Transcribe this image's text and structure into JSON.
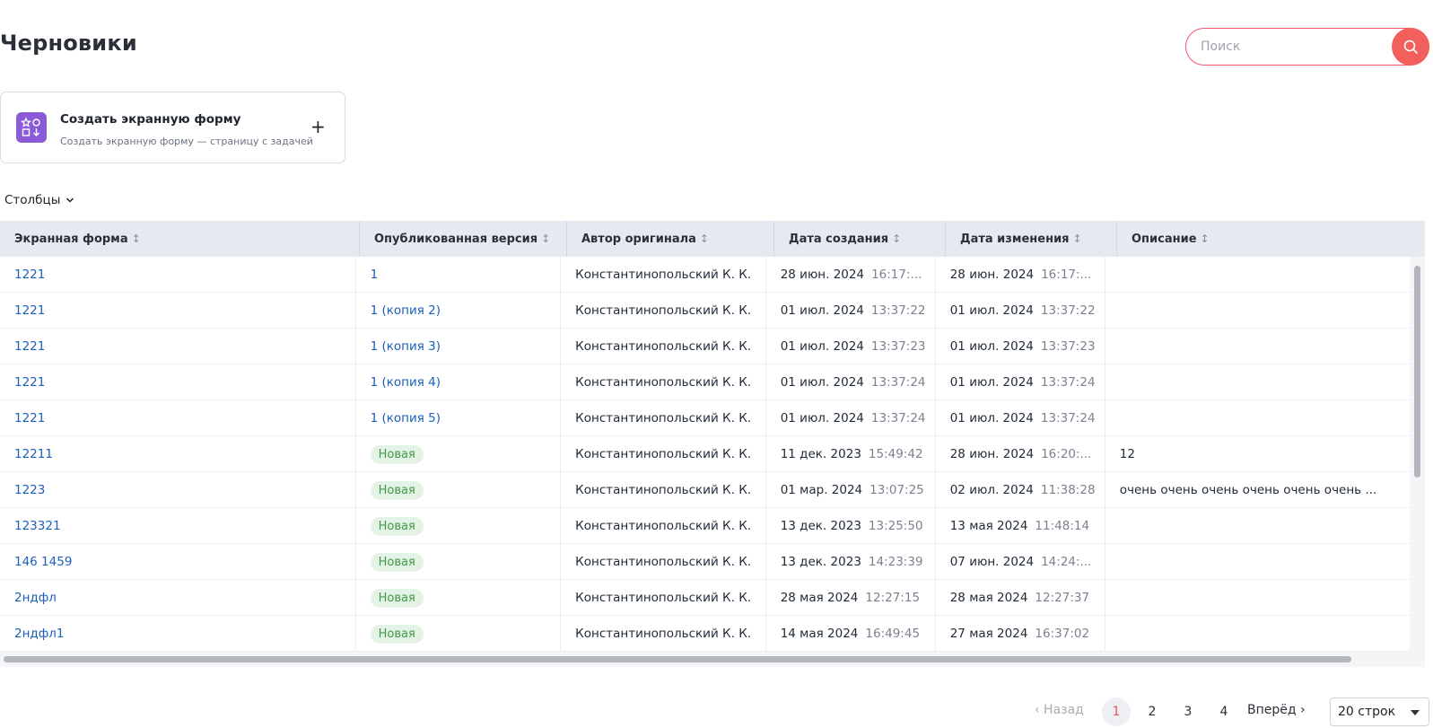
{
  "page": {
    "title": "Черновики"
  },
  "search": {
    "placeholder": "Поиск"
  },
  "create_card": {
    "title": "Создать экранную форму",
    "subtitle": "Создать экранную форму — страницу с задачей",
    "plus": "+"
  },
  "columns_toggle": {
    "label": "Столбцы"
  },
  "table": {
    "headers": [
      "Экранная форма",
      "Опубликованная версия",
      "Автор оригинала",
      "Дата создания",
      "Дата изменения",
      "Описание"
    ],
    "sort_glyph": "↕",
    "rows": [
      {
        "form": "1221",
        "version": "1",
        "version_type": "link",
        "author": "Константинопольский К. К.",
        "created_date": "28 июн. 2024",
        "created_time": "16:17:...",
        "modified_date": "28 июн. 2024",
        "modified_time": "16:17:...",
        "description": ""
      },
      {
        "form": "1221",
        "version": "1 (копия 2)",
        "version_type": "link",
        "author": "Константинопольский К. К.",
        "created_date": "01 июл. 2024",
        "created_time": "13:37:22",
        "modified_date": "01 июл. 2024",
        "modified_time": "13:37:22",
        "description": ""
      },
      {
        "form": "1221",
        "version": "1 (копия 3)",
        "version_type": "link",
        "author": "Константинопольский К. К.",
        "created_date": "01 июл. 2024",
        "created_time": "13:37:23",
        "modified_date": "01 июл. 2024",
        "modified_time": "13:37:23",
        "description": ""
      },
      {
        "form": "1221",
        "version": "1 (копия 4)",
        "version_type": "link",
        "author": "Константинопольский К. К.",
        "created_date": "01 июл. 2024",
        "created_time": "13:37:24",
        "modified_date": "01 июл. 2024",
        "modified_time": "13:37:24",
        "description": ""
      },
      {
        "form": "1221",
        "version": "1 (копия 5)",
        "version_type": "link",
        "author": "Константинопольский К. К.",
        "created_date": "01 июл. 2024",
        "created_time": "13:37:24",
        "modified_date": "01 июл. 2024",
        "modified_time": "13:37:24",
        "description": ""
      },
      {
        "form": "12211",
        "version": "Новая",
        "version_type": "badge",
        "author": "Константинопольский К. К.",
        "created_date": "11 дек. 2023",
        "created_time": "15:49:42",
        "modified_date": "28 июн. 2024",
        "modified_time": "16:20:...",
        "description": "12"
      },
      {
        "form": "1223",
        "version": "Новая",
        "version_type": "badge",
        "author": "Константинопольский К. К.",
        "created_date": "01 мар. 2024",
        "created_time": "13:07:25",
        "modified_date": "02 июл. 2024",
        "modified_time": "11:38:28",
        "description": "очень очень очень очень очень очень ..."
      },
      {
        "form": "123321",
        "version": "Новая",
        "version_type": "badge",
        "author": "Константинопольский К. К.",
        "created_date": "13 дек. 2023",
        "created_time": "13:25:50",
        "modified_date": "13 мая 2024",
        "modified_time": "11:48:14",
        "description": ""
      },
      {
        "form": "146 1459",
        "version": "Новая",
        "version_type": "badge",
        "author": "Константинопольский К. К.",
        "created_date": "13 дек. 2023",
        "created_time": "14:23:39",
        "modified_date": "07 июн. 2024",
        "modified_time": "14:24:...",
        "description": ""
      },
      {
        "form": "2ндфл",
        "version": "Новая",
        "version_type": "badge",
        "author": "Константинопольский К. К.",
        "created_date": "28 мая 2024",
        "created_time": "12:27:15",
        "modified_date": "28 мая 2024",
        "modified_time": "12:27:37",
        "description": ""
      },
      {
        "form": "2ндфл1",
        "version": "Новая",
        "version_type": "badge",
        "author": "Константинопольский К. К.",
        "created_date": "14 мая 2024",
        "created_time": "16:49:45",
        "modified_date": "27 мая 2024",
        "modified_time": "16:37:02",
        "description": ""
      }
    ]
  },
  "pagination": {
    "prev": "‹ Назад",
    "pages": [
      "1",
      "2",
      "3",
      "4"
    ],
    "current": "1",
    "next": "Вперёд ›",
    "rows_per_page": "20 строк"
  },
  "colors": {
    "accent": "#f25f5c",
    "link": "#1c5fb8",
    "badge_bg": "#e5f3e6",
    "badge_text": "#3f9a48",
    "header_bg": "#e6e9f0",
    "card_icon": "#8a5bd6"
  }
}
